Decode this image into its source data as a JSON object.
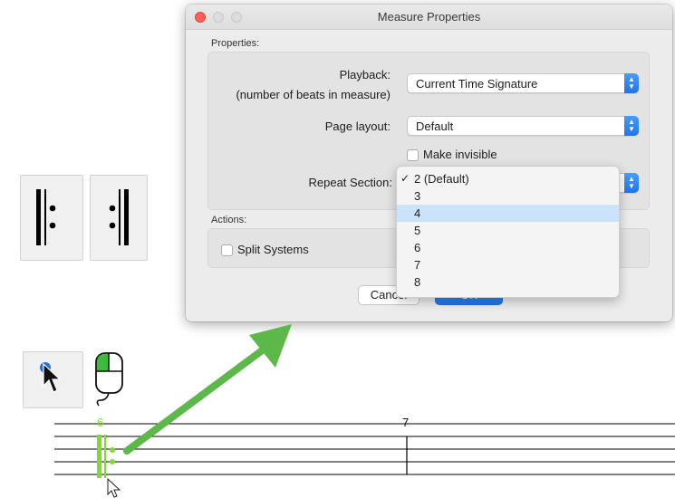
{
  "dialog": {
    "title": "Measure Properties",
    "properties_label": "Properties:",
    "playback_label": "Playback:",
    "playback_sublabel": "(number of beats in measure)",
    "playback_value": "Current Time Signature",
    "page_layout_label": "Page layout:",
    "page_layout_value": "Default",
    "make_invisible_label": "Make invisible",
    "repeat_section_label": "Repeat Section:",
    "actions_label": "Actions:",
    "split_systems_label": "Split Systems",
    "cancel_label": "Cancel",
    "ok_label": "OK"
  },
  "repeat_menu": {
    "items": [
      "2 (Default)",
      "3",
      "4",
      "5",
      "6",
      "7",
      "8"
    ],
    "checked_index": 0,
    "highlighted_index": 2
  },
  "score": {
    "measure_selected": "6",
    "measure_next": "7",
    "selection_color": "#7ddc2c"
  },
  "colors": {
    "accent": "#1f74e8",
    "arrow": "#5cb848",
    "highlight": "#cbe2fb"
  },
  "icons": [
    "repeat-start-icon",
    "repeat-end-icon",
    "pointer-tool-icon",
    "mouse-left-click-icon",
    "cursor-icon",
    "arrow-icon"
  ]
}
